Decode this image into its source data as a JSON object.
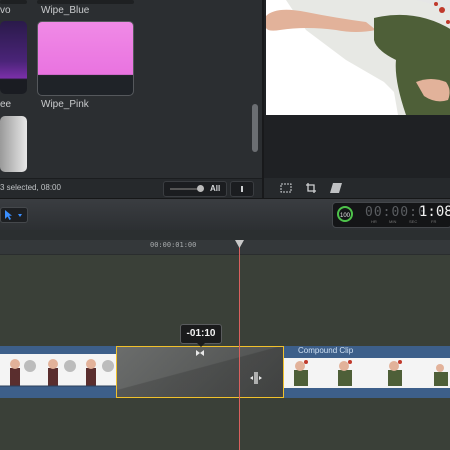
{
  "browser": {
    "thumbs": [
      {
        "label": "vo"
      },
      {
        "label": "Wipe_Blue"
      },
      {
        "label": "ee"
      },
      {
        "label": "Wipe_Pink"
      }
    ],
    "status": "3 selected, 08:00",
    "all_label": "All"
  },
  "viewer": {
    "tools": [
      "crop-tool",
      "transform-tool",
      "distort-tool"
    ]
  },
  "toolbar": {
    "timecode_gauge": "100",
    "timecode_dim": "00:00:0",
    "timecode_bright": "1:08",
    "timecode_units": [
      "HR",
      "MIN",
      "SEC",
      "FR"
    ]
  },
  "timeline": {
    "ruler_time": "00:00:01:00",
    "tooltip": "-01:10",
    "compound_label": "Compound Clip"
  },
  "colors": {
    "accent_yellow": "#f1c12c",
    "playhead": "#d9605e",
    "clip_blue": "#3d5f8a",
    "timecode_green": "#4ec24b"
  }
}
